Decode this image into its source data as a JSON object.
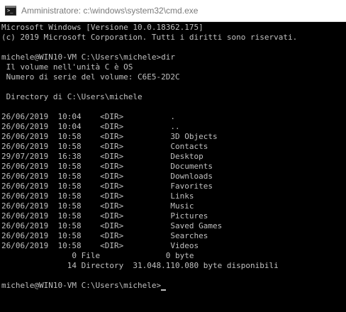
{
  "window": {
    "title": "Amministratore: c:\\windows\\system32\\cmd.exe",
    "icon": "cmd-icon",
    "icon_glyph": ">_"
  },
  "colors": {
    "console_bg": "#000000",
    "console_fg": "#c0c0c0",
    "titlebar_bg": "#ffffff",
    "title_fg": "#7a7a7a"
  },
  "console": {
    "lines": [
      "Microsoft Windows [Versione 10.0.18362.175]",
      "(c) 2019 Microsoft Corporation. Tutti i diritti sono riservati.",
      "",
      "michele@WIN10-VM C:\\Users\\michele>dir",
      " Il volume nell'unità C è OS",
      " Numero di serie del volume: C6E5-2D2C",
      "",
      " Directory di C:\\Users\\michele",
      "",
      "26/06/2019  10:04    <DIR>          .",
      "26/06/2019  10:04    <DIR>          ..",
      "26/06/2019  10:58    <DIR>          3D Objects",
      "26/06/2019  10:58    <DIR>          Contacts",
      "29/07/2019  16:38    <DIR>          Desktop",
      "26/06/2019  10:58    <DIR>          Documents",
      "26/06/2019  10:58    <DIR>          Downloads",
      "26/06/2019  10:58    <DIR>          Favorites",
      "26/06/2019  10:58    <DIR>          Links",
      "26/06/2019  10:58    <DIR>          Music",
      "26/06/2019  10:58    <DIR>          Pictures",
      "26/06/2019  10:58    <DIR>          Saved Games",
      "26/06/2019  10:58    <DIR>          Searches",
      "26/06/2019  10:58    <DIR>          Videos",
      "               0 File              0 byte",
      "              14 Directory  31.048.110.080 byte disponibili",
      "",
      "michele@WIN10-VM C:\\Users\\michele>"
    ]
  }
}
